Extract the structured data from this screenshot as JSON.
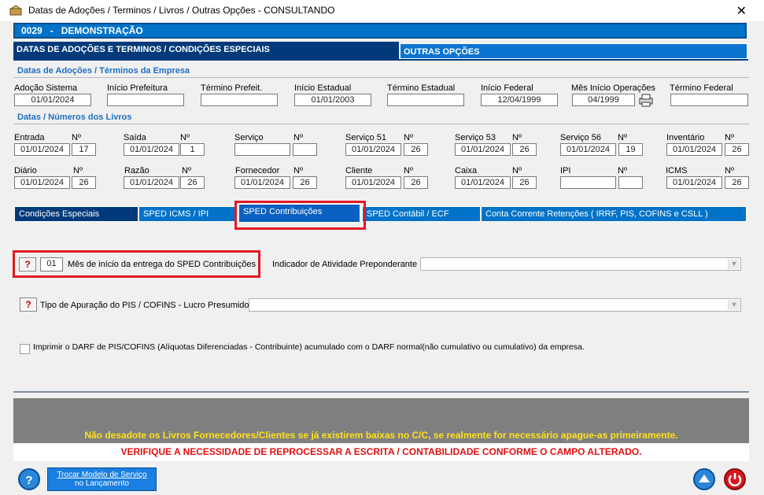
{
  "window": {
    "title": "Datas de Adoções / Terminos / Livros / Outras Opções - CONSULTANDO",
    "close": "✕"
  },
  "company": {
    "code": "0029",
    "sep": "-",
    "name": "DEMONSTRAÇÃO"
  },
  "main_tabs": {
    "tab1": "DATAS DE ADOÇÕES E TERMINOS / CONDIÇÕES ESPECIAIS",
    "tab2": "OUTRAS OPÇÕES"
  },
  "adocoes": {
    "title": "Datas de Adoções / Términos da Empresa",
    "fields": [
      {
        "label": "Adoção Sistema",
        "value": "01/01/2024"
      },
      {
        "label": "Início Prefeitura",
        "value": ""
      },
      {
        "label": "Término Prefeit.",
        "value": ""
      },
      {
        "label": "Início Estadual",
        "value": "01/01/2003"
      },
      {
        "label": "Término Estadual",
        "value": ""
      },
      {
        "label": "Início Federal",
        "value": "12/04/1999"
      },
      {
        "label": "Mês Início Operações",
        "value": "04/1999"
      },
      {
        "label": "Término Federal",
        "value": ""
      }
    ]
  },
  "livros": {
    "title": "Datas / Números dos Livros",
    "num_label": "Nº",
    "row1": [
      {
        "label": "Entrada",
        "date": "01/01/2024",
        "num": "17"
      },
      {
        "label": "Saída",
        "date": "01/01/2024",
        "num": "1"
      },
      {
        "label": "Serviço",
        "date": "",
        "num": ""
      },
      {
        "label": "Serviço 51",
        "date": "01/01/2024",
        "num": "26"
      },
      {
        "label": "Serviço 53",
        "date": "01/01/2024",
        "num": "26"
      },
      {
        "label": "Serviço 56",
        "date": "01/01/2024",
        "num": "19"
      },
      {
        "label": "Inventário",
        "date": "01/01/2024",
        "num": "26"
      }
    ],
    "row2": [
      {
        "label": "Diário",
        "date": "01/01/2024",
        "num": "26"
      },
      {
        "label": "Razão",
        "date": "01/01/2024",
        "num": "26"
      },
      {
        "label": "Fornecedor",
        "date": "01/01/2024",
        "num": "26"
      },
      {
        "label": "Cliente",
        "date": "01/01/2024",
        "num": "26"
      },
      {
        "label": "Caixa",
        "date": "01/01/2024",
        "num": "26"
      },
      {
        "label": "IPI",
        "date": "",
        "num": ""
      },
      {
        "label": "ICMS",
        "date": "01/01/2024",
        "num": "26"
      }
    ]
  },
  "sub_tabs": [
    "Condições Especiais",
    "SPED ICMS / IPI",
    "SPED Contribuições",
    "SPED Contábil / ECF",
    "Conta Corrente Retenções ( IRRF, PIS, COFINS  e  CSLL )"
  ],
  "sped": {
    "help_label": "?",
    "mes_inicio_value": "01",
    "mes_inicio_label": "Mês de início da entrega do SPED Contribuições",
    "indicador_label": "Indicador de Atividade Preponderante",
    "indicador_value": "",
    "apuracao_label": "Tipo de Apuração do PIS / COFINS - Lucro Presumido:",
    "apuracao_value": "",
    "darf_label": "Imprimir o DARF de PIS/COFINS (Alíquotas Diferenciadas - Contribuinte) acumulado com o DARF normal(não cumulativo ou cumulativo) da empresa."
  },
  "warnings": {
    "yellow": "Não desadote os Livros Fornecedores/Clientes se já existirem baixas no C/C, se realmente for necessário apague-as primeiramente.",
    "red": "VERIFIQUE A NECESSIDADE DE REPROCESSAR A ESCRITA / CONTABILIDADE CONFORME O CAMPO ALTERADO."
  },
  "footer": {
    "help": "?",
    "trocar_line1": "Trocar Modelo de Serviço",
    "trocar_line2": "no Lançamento"
  },
  "colors": {
    "accent": "#0073c9",
    "dark_tab": "#003a7a",
    "highlight": "#e01a24",
    "warning_yellow": "#ffe11a"
  }
}
